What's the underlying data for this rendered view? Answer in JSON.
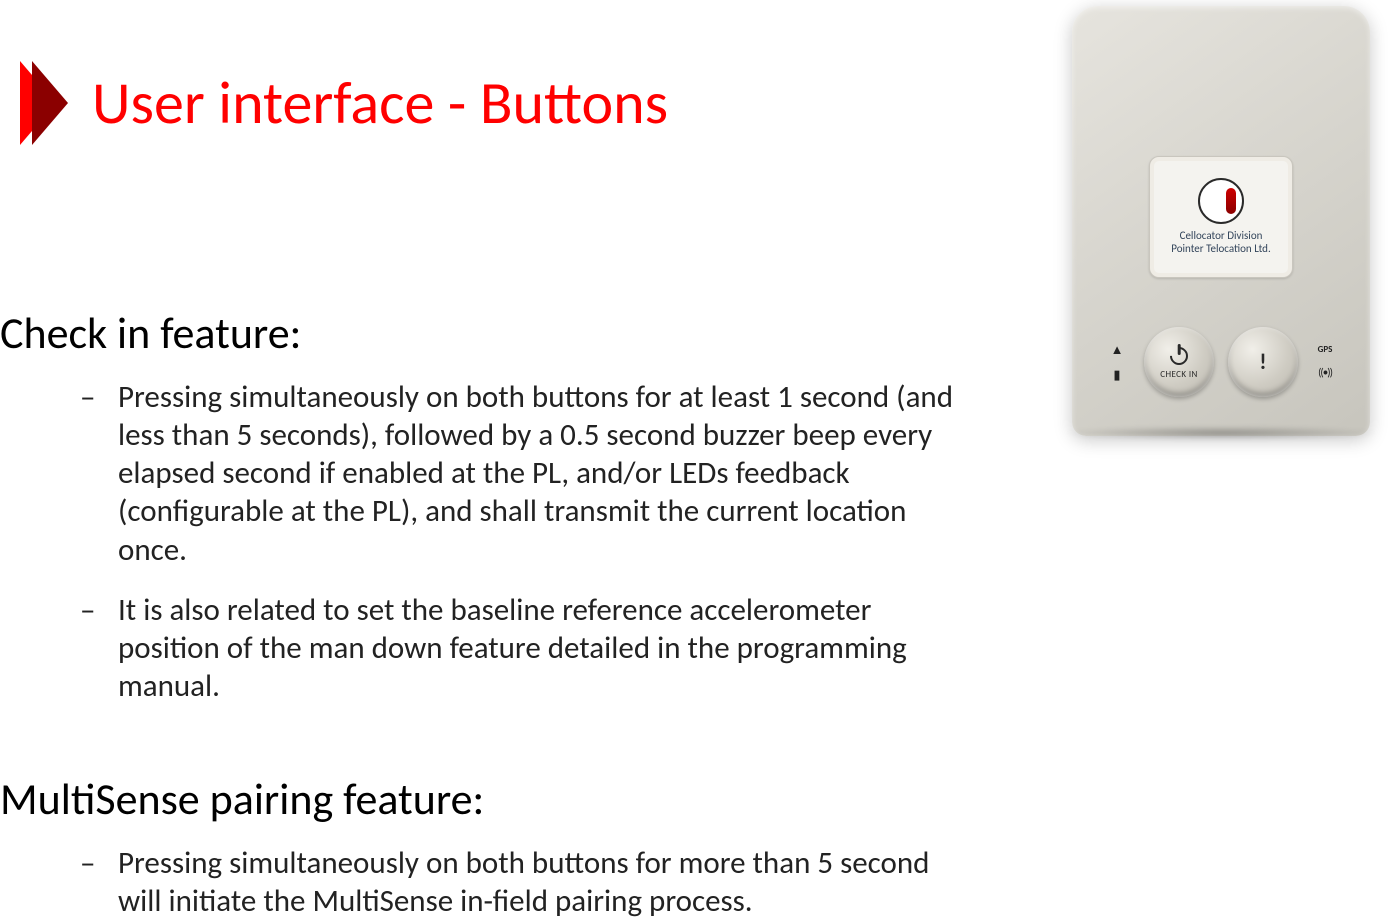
{
  "title": "User interface - Buttons",
  "sections": [
    {
      "heading": "Check in feature:",
      "bullets": [
        "Pressing simultaneously on both buttons for at least 1 second (and less than 5 seconds), followed by a 0.5 second buzzer beep every elapsed second if enabled at the PL, and/or LEDs feedback (configurable at the PL), and shall transmit the current location once.",
        "It is also related to set the baseline reference accelerometer position of the man down feature detailed in the programming manual."
      ]
    },
    {
      "heading": "MultiSense pairing feature:",
      "bullets": [
        "Pressing simultaneously on both buttons for more than 5 second will initiate the MultiSense in-field pairing process."
      ]
    }
  ],
  "device": {
    "sticker_line1": "Cellocator Division",
    "sticker_line2": "Pointer Telocation Ltd.",
    "left_button_label": "CHECK IN",
    "right_led_label": "GPS"
  },
  "colors": {
    "title": "#ff0000",
    "body_text": "#222222"
  }
}
